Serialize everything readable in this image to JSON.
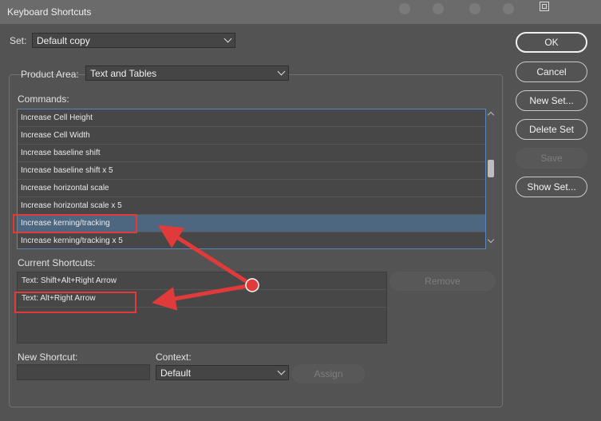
{
  "window": {
    "title": "Keyboard Shortcuts"
  },
  "set": {
    "label": "Set:",
    "value": "Default copy"
  },
  "product_area": {
    "label": "Product Area:",
    "value": "Text and Tables"
  },
  "commands": {
    "label": "Commands:",
    "items": [
      "Increase Cell Height",
      "Increase Cell Width",
      "Increase baseline shift",
      "Increase baseline shift x 5",
      "Increase horizontal scale",
      "Increase horizontal scale x 5",
      "Increase kerning/tracking",
      "Increase kerning/tracking x 5"
    ],
    "selected_index": 6
  },
  "current_shortcuts": {
    "label": "Current Shortcuts:",
    "items": [
      "Text: Shift+Alt+Right Arrow",
      "Text: Alt+Right Arrow"
    ]
  },
  "new_shortcut": {
    "label": "New Shortcut:",
    "value": ""
  },
  "context": {
    "label": "Context:",
    "value": "Default"
  },
  "buttons": {
    "ok": "OK",
    "cancel": "Cancel",
    "new_set": "New Set...",
    "delete_set": "Delete Set",
    "save": "Save",
    "show_set": "Show Set...",
    "remove": "Remove",
    "assign": "Assign"
  },
  "annotation": {
    "color": "#e03a3a"
  }
}
